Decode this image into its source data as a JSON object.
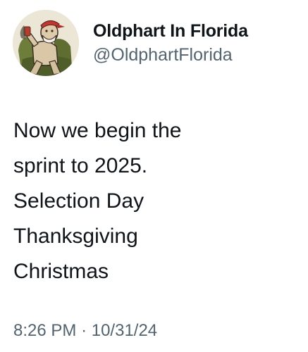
{
  "user": {
    "display_name": "Oldphart In Florida",
    "handle": "@OldphartFlorida",
    "avatar_icon": "cartoon-old-man-in-armchair-avatar"
  },
  "tweet": {
    "lines": [
      "Now we begin the",
      "sprint to 2025.",
      "Selection Day",
      "Thanksgiving",
      "Christmas"
    ],
    "time": "8:26 PM",
    "separator": "·",
    "date": "10/31/24"
  },
  "colors": {
    "text": "#0f1419",
    "secondary": "#536471",
    "background": "#ffffff"
  }
}
